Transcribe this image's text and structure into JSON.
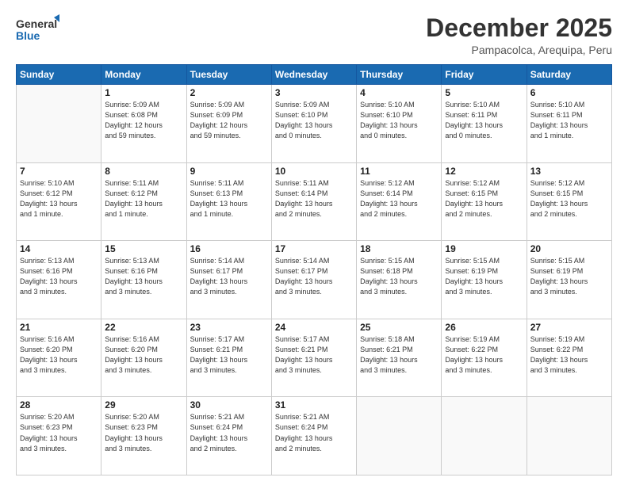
{
  "header": {
    "logo_line1": "General",
    "logo_line2": "Blue",
    "title": "December 2025",
    "subtitle": "Pampacolca, Arequipa, Peru"
  },
  "weekdays": [
    "Sunday",
    "Monday",
    "Tuesday",
    "Wednesday",
    "Thursday",
    "Friday",
    "Saturday"
  ],
  "weeks": [
    [
      {
        "day": "",
        "info": ""
      },
      {
        "day": "1",
        "info": "Sunrise: 5:09 AM\nSunset: 6:08 PM\nDaylight: 12 hours\nand 59 minutes."
      },
      {
        "day": "2",
        "info": "Sunrise: 5:09 AM\nSunset: 6:09 PM\nDaylight: 12 hours\nand 59 minutes."
      },
      {
        "day": "3",
        "info": "Sunrise: 5:09 AM\nSunset: 6:10 PM\nDaylight: 13 hours\nand 0 minutes."
      },
      {
        "day": "4",
        "info": "Sunrise: 5:10 AM\nSunset: 6:10 PM\nDaylight: 13 hours\nand 0 minutes."
      },
      {
        "day": "5",
        "info": "Sunrise: 5:10 AM\nSunset: 6:11 PM\nDaylight: 13 hours\nand 0 minutes."
      },
      {
        "day": "6",
        "info": "Sunrise: 5:10 AM\nSunset: 6:11 PM\nDaylight: 13 hours\nand 1 minute."
      }
    ],
    [
      {
        "day": "7",
        "info": "Sunrise: 5:10 AM\nSunset: 6:12 PM\nDaylight: 13 hours\nand 1 minute."
      },
      {
        "day": "8",
        "info": "Sunrise: 5:11 AM\nSunset: 6:12 PM\nDaylight: 13 hours\nand 1 minute."
      },
      {
        "day": "9",
        "info": "Sunrise: 5:11 AM\nSunset: 6:13 PM\nDaylight: 13 hours\nand 1 minute."
      },
      {
        "day": "10",
        "info": "Sunrise: 5:11 AM\nSunset: 6:14 PM\nDaylight: 13 hours\nand 2 minutes."
      },
      {
        "day": "11",
        "info": "Sunrise: 5:12 AM\nSunset: 6:14 PM\nDaylight: 13 hours\nand 2 minutes."
      },
      {
        "day": "12",
        "info": "Sunrise: 5:12 AM\nSunset: 6:15 PM\nDaylight: 13 hours\nand 2 minutes."
      },
      {
        "day": "13",
        "info": "Sunrise: 5:12 AM\nSunset: 6:15 PM\nDaylight: 13 hours\nand 2 minutes."
      }
    ],
    [
      {
        "day": "14",
        "info": "Sunrise: 5:13 AM\nSunset: 6:16 PM\nDaylight: 13 hours\nand 3 minutes."
      },
      {
        "day": "15",
        "info": "Sunrise: 5:13 AM\nSunset: 6:16 PM\nDaylight: 13 hours\nand 3 minutes."
      },
      {
        "day": "16",
        "info": "Sunrise: 5:14 AM\nSunset: 6:17 PM\nDaylight: 13 hours\nand 3 minutes."
      },
      {
        "day": "17",
        "info": "Sunrise: 5:14 AM\nSunset: 6:17 PM\nDaylight: 13 hours\nand 3 minutes."
      },
      {
        "day": "18",
        "info": "Sunrise: 5:15 AM\nSunset: 6:18 PM\nDaylight: 13 hours\nand 3 minutes."
      },
      {
        "day": "19",
        "info": "Sunrise: 5:15 AM\nSunset: 6:19 PM\nDaylight: 13 hours\nand 3 minutes."
      },
      {
        "day": "20",
        "info": "Sunrise: 5:15 AM\nSunset: 6:19 PM\nDaylight: 13 hours\nand 3 minutes."
      }
    ],
    [
      {
        "day": "21",
        "info": "Sunrise: 5:16 AM\nSunset: 6:20 PM\nDaylight: 13 hours\nand 3 minutes."
      },
      {
        "day": "22",
        "info": "Sunrise: 5:16 AM\nSunset: 6:20 PM\nDaylight: 13 hours\nand 3 minutes."
      },
      {
        "day": "23",
        "info": "Sunrise: 5:17 AM\nSunset: 6:21 PM\nDaylight: 13 hours\nand 3 minutes."
      },
      {
        "day": "24",
        "info": "Sunrise: 5:17 AM\nSunset: 6:21 PM\nDaylight: 13 hours\nand 3 minutes."
      },
      {
        "day": "25",
        "info": "Sunrise: 5:18 AM\nSunset: 6:21 PM\nDaylight: 13 hours\nand 3 minutes."
      },
      {
        "day": "26",
        "info": "Sunrise: 5:19 AM\nSunset: 6:22 PM\nDaylight: 13 hours\nand 3 minutes."
      },
      {
        "day": "27",
        "info": "Sunrise: 5:19 AM\nSunset: 6:22 PM\nDaylight: 13 hours\nand 3 minutes."
      }
    ],
    [
      {
        "day": "28",
        "info": "Sunrise: 5:20 AM\nSunset: 6:23 PM\nDaylight: 13 hours\nand 3 minutes."
      },
      {
        "day": "29",
        "info": "Sunrise: 5:20 AM\nSunset: 6:23 PM\nDaylight: 13 hours\nand 3 minutes."
      },
      {
        "day": "30",
        "info": "Sunrise: 5:21 AM\nSunset: 6:24 PM\nDaylight: 13 hours\nand 2 minutes."
      },
      {
        "day": "31",
        "info": "Sunrise: 5:21 AM\nSunset: 6:24 PM\nDaylight: 13 hours\nand 2 minutes."
      },
      {
        "day": "",
        "info": ""
      },
      {
        "day": "",
        "info": ""
      },
      {
        "day": "",
        "info": ""
      }
    ]
  ],
  "colors": {
    "header_bg": "#1a6ab1",
    "header_text": "#ffffff",
    "border": "#cccccc",
    "empty_bg": "#f9f9f9"
  }
}
